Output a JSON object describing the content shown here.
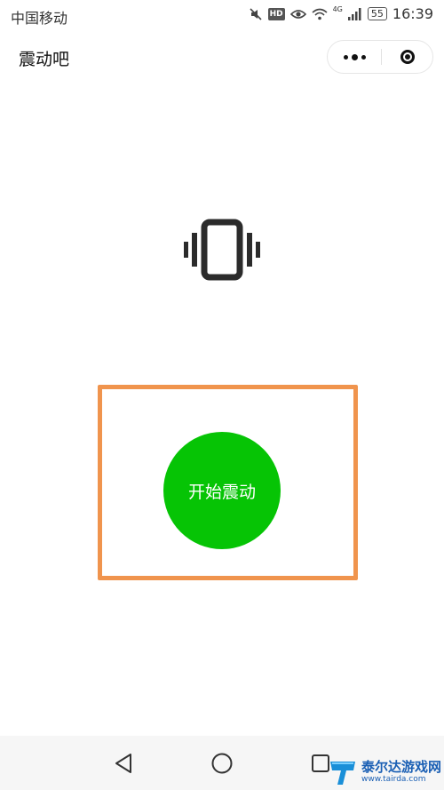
{
  "status_bar": {
    "carrier": "中国移动",
    "hd_badge": "HD",
    "network": "4G",
    "battery": "55",
    "time": "16:39",
    "icons": [
      "muted-icon",
      "hd-icon",
      "eye-icon",
      "wifi-icon",
      "signal-icon",
      "battery-icon"
    ]
  },
  "title_bar": {
    "title": "震动吧",
    "icons": [
      "more-icon",
      "close-target-icon"
    ]
  },
  "main": {
    "icon": "vibrate-phone-icon",
    "start_button_label": "开始震动",
    "highlight_color": "#f0944d",
    "button_color": "#06c405"
  },
  "nav_bar": {
    "icons": [
      "back-triangle-icon",
      "home-circle-icon",
      "recents-square-icon"
    ]
  },
  "watermark": {
    "title": "泰尔达游戏网",
    "url": "www.tairda.com"
  }
}
